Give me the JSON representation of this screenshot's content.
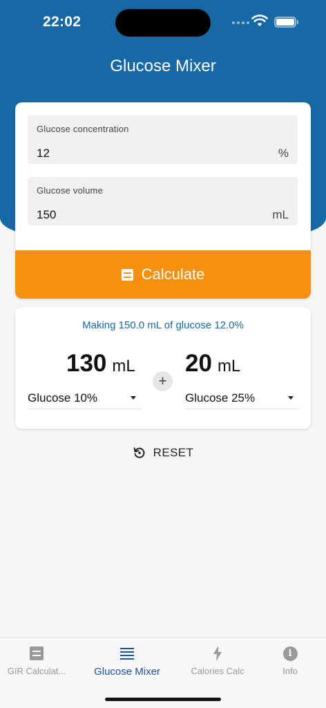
{
  "status": {
    "time": "22:02"
  },
  "header": {
    "title": "Glucose Mixer"
  },
  "inputs": {
    "concentration": {
      "label": "Glucose concentration",
      "value": "12",
      "unit": "%"
    },
    "volume": {
      "label": "Glucose volume",
      "value": "150",
      "unit": "mL"
    },
    "calculate_label": "Calculate"
  },
  "result": {
    "message": "Making 150.0 mL of glucose 12.0%",
    "first": {
      "amount": "130",
      "unit": "mL",
      "solution": "Glucose 10%"
    },
    "plus": "+",
    "second": {
      "amount": "20",
      "unit": "mL",
      "solution": "Glucose 25%"
    }
  },
  "reset_label": "RESET",
  "tabs": [
    {
      "label": "GIR Calculat...",
      "icon": "calculator-icon",
      "active": false
    },
    {
      "label": "Glucose Mixer",
      "icon": "lines-icon",
      "active": true
    },
    {
      "label": "Calories Calc",
      "icon": "bolt-icon",
      "active": false
    },
    {
      "label": "Info",
      "icon": "info-icon",
      "active": false
    }
  ],
  "colors": {
    "primary": "#1769a6",
    "accent": "#f5900f",
    "active_tab": "#1f4fa3",
    "inactive_tab": "#999999"
  }
}
